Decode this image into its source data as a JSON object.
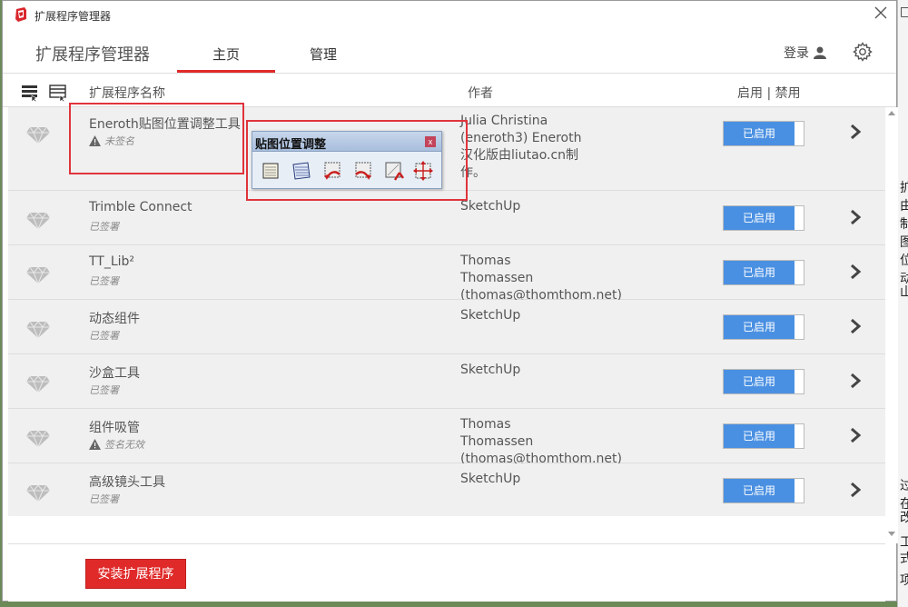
{
  "window": {
    "title": "扩展程序管理器"
  },
  "header": {
    "title": "扩展程序管理器",
    "tabs": [
      "主页",
      "管理"
    ],
    "login_label": "登录"
  },
  "columns": {
    "name": "扩展程序名称",
    "author": "作者",
    "enable": "启用 | 禁用"
  },
  "extensions": [
    {
      "name": "Eneroth贴图位置调整工具",
      "status": "未签名",
      "status_warning": true,
      "author": "Julia Christina\n(eneroth3) Eneroth\n汉化版由liutao.cn制\n作。",
      "toggle": "已启用"
    },
    {
      "name": "Trimble Connect",
      "status": "已签署",
      "status_warning": false,
      "author": "SketchUp",
      "toggle": "已启用"
    },
    {
      "name": "TT_Lib²",
      "status": "已签署",
      "status_warning": false,
      "author": "Thomas Thomassen\n(thomas@thomthom.net)",
      "toggle": "已启用"
    },
    {
      "name": "动态组件",
      "status": "已签署",
      "status_warning": false,
      "author": "SketchUp",
      "toggle": "已启用"
    },
    {
      "name": "沙盒工具",
      "status": "已签署",
      "status_warning": false,
      "author": "SketchUp",
      "toggle": "已启用"
    },
    {
      "name": "组件吸管",
      "status": "签名无效",
      "status_warning": true,
      "author": "Thomas Thomassen\n(thomas@thomthom.net)",
      "toggle": "已启用"
    },
    {
      "name": "高级镜头工具",
      "status": "已签署",
      "status_warning": false,
      "author": "SketchUp",
      "toggle": "已启用"
    }
  ],
  "footer": {
    "install_label": "安装扩展程序"
  },
  "floating_toolbar": {
    "title": "贴图位置调整",
    "close_label": "x",
    "buttons": [
      "texture-flat-icon",
      "texture-skew-icon",
      "rotate-left-icon",
      "rotate-right-icon",
      "flip-icon",
      "scale-arrows-icon"
    ]
  },
  "colors": {
    "accent_red": "#e02a2a",
    "toggle_blue": "#4a90e2",
    "highlight_red": "#e0343c"
  }
}
